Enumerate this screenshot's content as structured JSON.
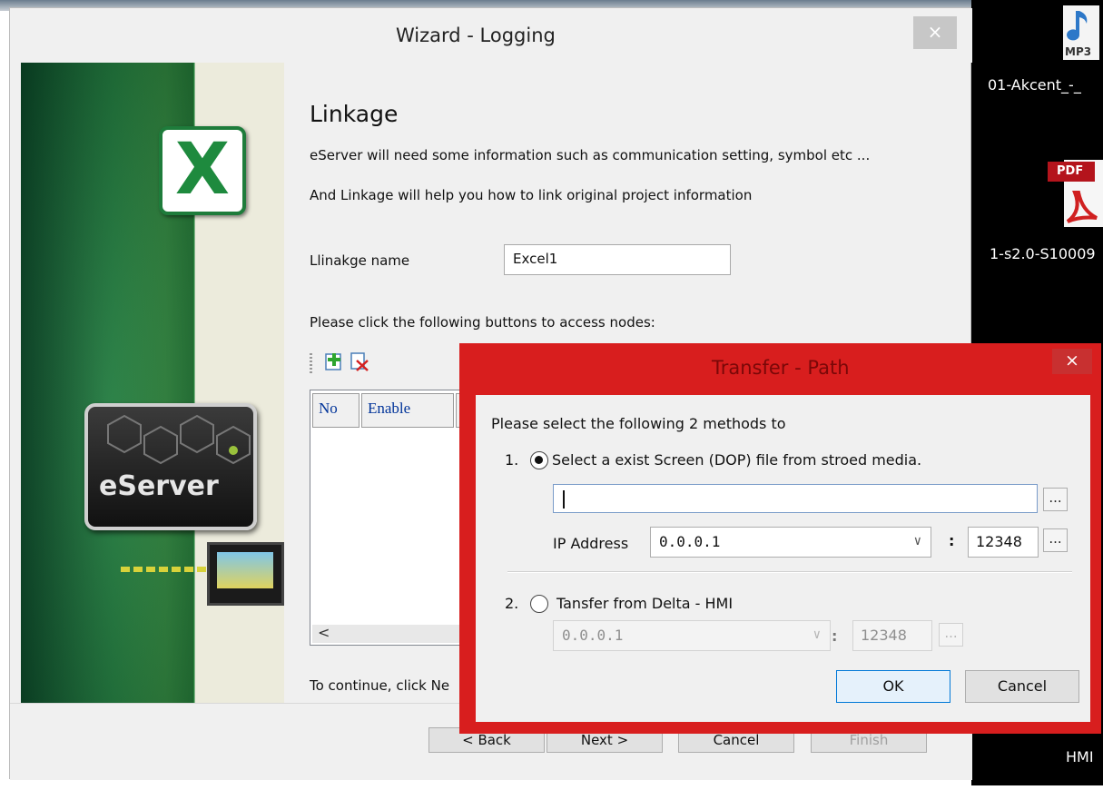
{
  "wizard": {
    "title": "Wizard - Logging",
    "close_glyph": "×",
    "heading": "Linkage",
    "description_line1": "eServer will need some information such as communication setting, symbol etc ...",
    "description_line2": "And Linkage will help you how to link original project information",
    "linkage_name_label": "Llinakge name",
    "linkage_name_value": "Excel1",
    "nodes_prompt": "Please click the following buttons to access nodes:",
    "grid_columns": [
      "No",
      "Enable"
    ],
    "scroll_left_glyph": "<",
    "continue_text": "To continue, click Ne",
    "buttons": {
      "back": "< Back",
      "next": "Next >",
      "cancel": "Cancel",
      "finish": "Finish"
    },
    "banner_logo_text": "eServer"
  },
  "transfer_dialog": {
    "title": "Transfer - Path",
    "close_glyph": "×",
    "prompt": "Please select the following 2 methods to",
    "option1": {
      "number": "1.",
      "label": "Select a exist  Screen (DOP) file from stroed media.",
      "selected": true,
      "path_value": "",
      "browse_label": "...",
      "ip_label": "IP Address",
      "ip_value": "0.0.0.1",
      "port_value": "12348"
    },
    "option2": {
      "number": "2.",
      "label": "Tansfer from Delta - HMI",
      "selected": false,
      "ip_value": "0.0.0.1",
      "port_value": "12348",
      "browse_label": "..."
    },
    "colon": ":",
    "dropdown_glyph": "∨",
    "ok_label": "OK",
    "cancel_label": "Cancel"
  },
  "desktop": {
    "icons": [
      {
        "name": "mp3",
        "badge": "MP3",
        "label": "01-Akcent_-_"
      },
      {
        "name": "pdf",
        "badge": "PDF",
        "label": "1-s2.0-S10009"
      },
      {
        "name": "hmi",
        "label": "HMI"
      }
    ]
  },
  "colors": {
    "dialog_accent": "#d81e1e",
    "title_text_dim": "#7a0808",
    "ok_border": "#0078d7",
    "banner_green": "#1d7a3b"
  }
}
